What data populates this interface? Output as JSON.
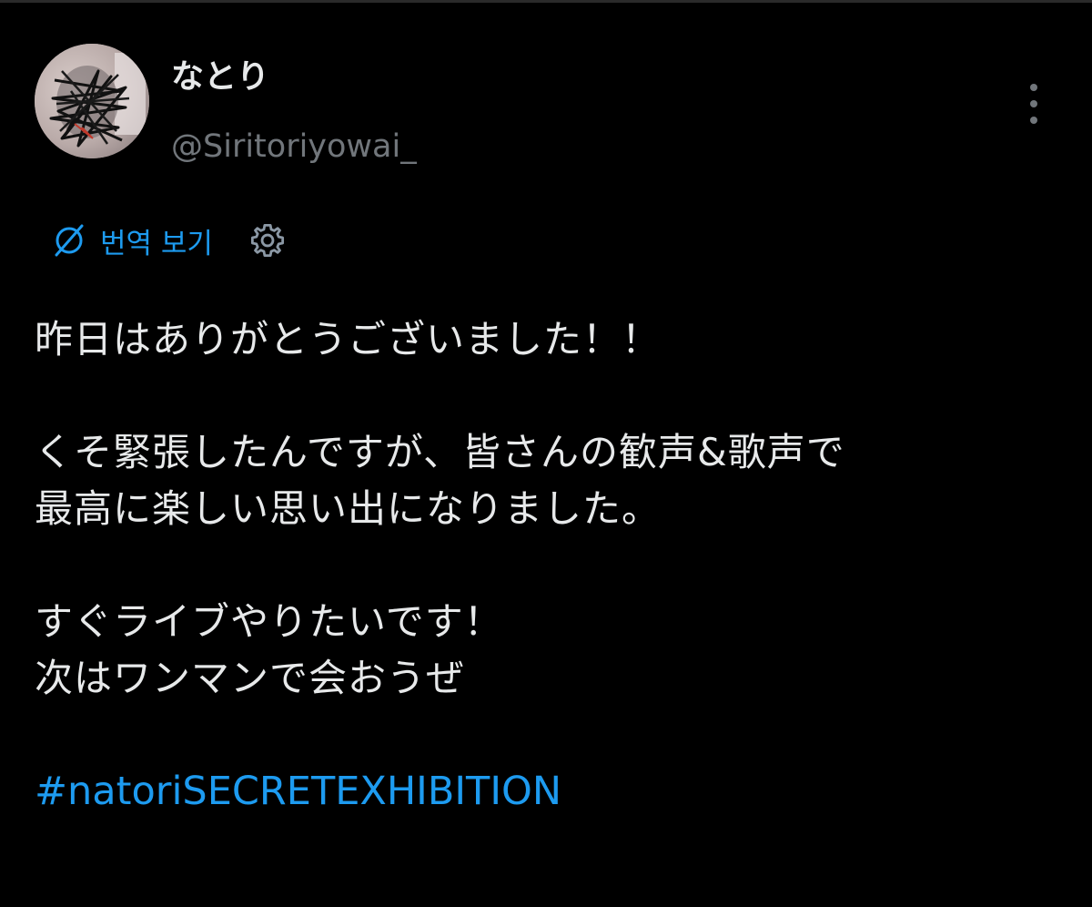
{
  "user": {
    "display_name": "なとり",
    "handle": "@Siritoriyowai_"
  },
  "translate": {
    "label": "번역 보기"
  },
  "tweet": {
    "line1": "昨日はありがとうございました！！",
    "line2": "くそ緊張したんですが、皆さんの歓声&歌声で",
    "line3": "最高に楽しい思い出になりました。",
    "line4": "すぐライブやりたいです！",
    "line5": "次はワンマンで会おうぜ",
    "hashtag": "#natoriSECRETEXHIBITION"
  },
  "colors": {
    "background": "#000000",
    "text": "#e7e9ea",
    "secondary_text": "#71767b",
    "accent": "#1d9bf0"
  },
  "icons": {
    "translate": "translate-globe-slash-icon",
    "settings": "gear-icon",
    "more": "more-vertical-icon"
  }
}
